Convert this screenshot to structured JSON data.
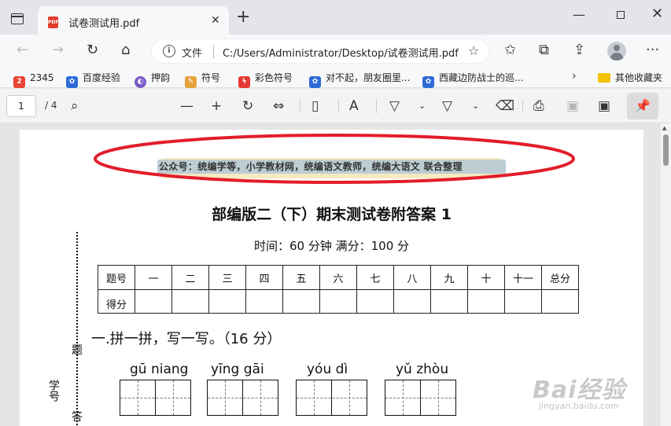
{
  "tab": {
    "title": "试卷测试用.pdf",
    "favicon": "PDF"
  },
  "address": {
    "label": "文件",
    "url": "C:/Users/Administrator/Desktop/试卷测试用.pdf"
  },
  "bookmarks": [
    {
      "label": "2345",
      "icon": "2345-icon",
      "color": "#e94335"
    },
    {
      "label": "百度经验",
      "icon": "paw-icon",
      "color": "#2f6ad9"
    },
    {
      "label": "押韵",
      "icon": "circle-icon",
      "color": "#7a5ac9"
    },
    {
      "label": "符号",
      "icon": "pencil-icon",
      "color": "#e6a23c"
    },
    {
      "label": "彩色符号",
      "icon": "lightning-icon",
      "color": "#e53935"
    },
    {
      "label": "对不起，朋友圈里...",
      "icon": "paw-icon",
      "color": "#2f6ad9"
    },
    {
      "label": "西藏边防战士的巡...",
      "icon": "paw-icon",
      "color": "#2f6ad9"
    }
  ],
  "bookmark_folder": "其他收藏夹",
  "pdf_toolbar": {
    "page_current": "1",
    "page_total": "/ 4"
  },
  "document": {
    "header": "公众号：统编学等，小学教材网，统编语文教师，统编大语文 联合整理",
    "title": "部编版二（下）期末测试卷附答案 1",
    "meta": "时间：60 分钟   满分：100 分",
    "side_labels": [
      "题",
      "答",
      "学号"
    ],
    "score_table": {
      "header": [
        "题号",
        "一",
        "二",
        "三",
        "四",
        "五",
        "六",
        "七",
        "八",
        "九",
        "十",
        "十一",
        "总分"
      ],
      "row_label": "得分"
    },
    "section1": "一.拼一拼，写一写。（16 分）",
    "pinyin": [
      "gū  niang",
      "yīng gāi",
      "yóu   dì",
      "yǔ zhòu"
    ]
  },
  "watermark": {
    "main": "Bai经验",
    "sub": "jingyan.baidu.com"
  }
}
